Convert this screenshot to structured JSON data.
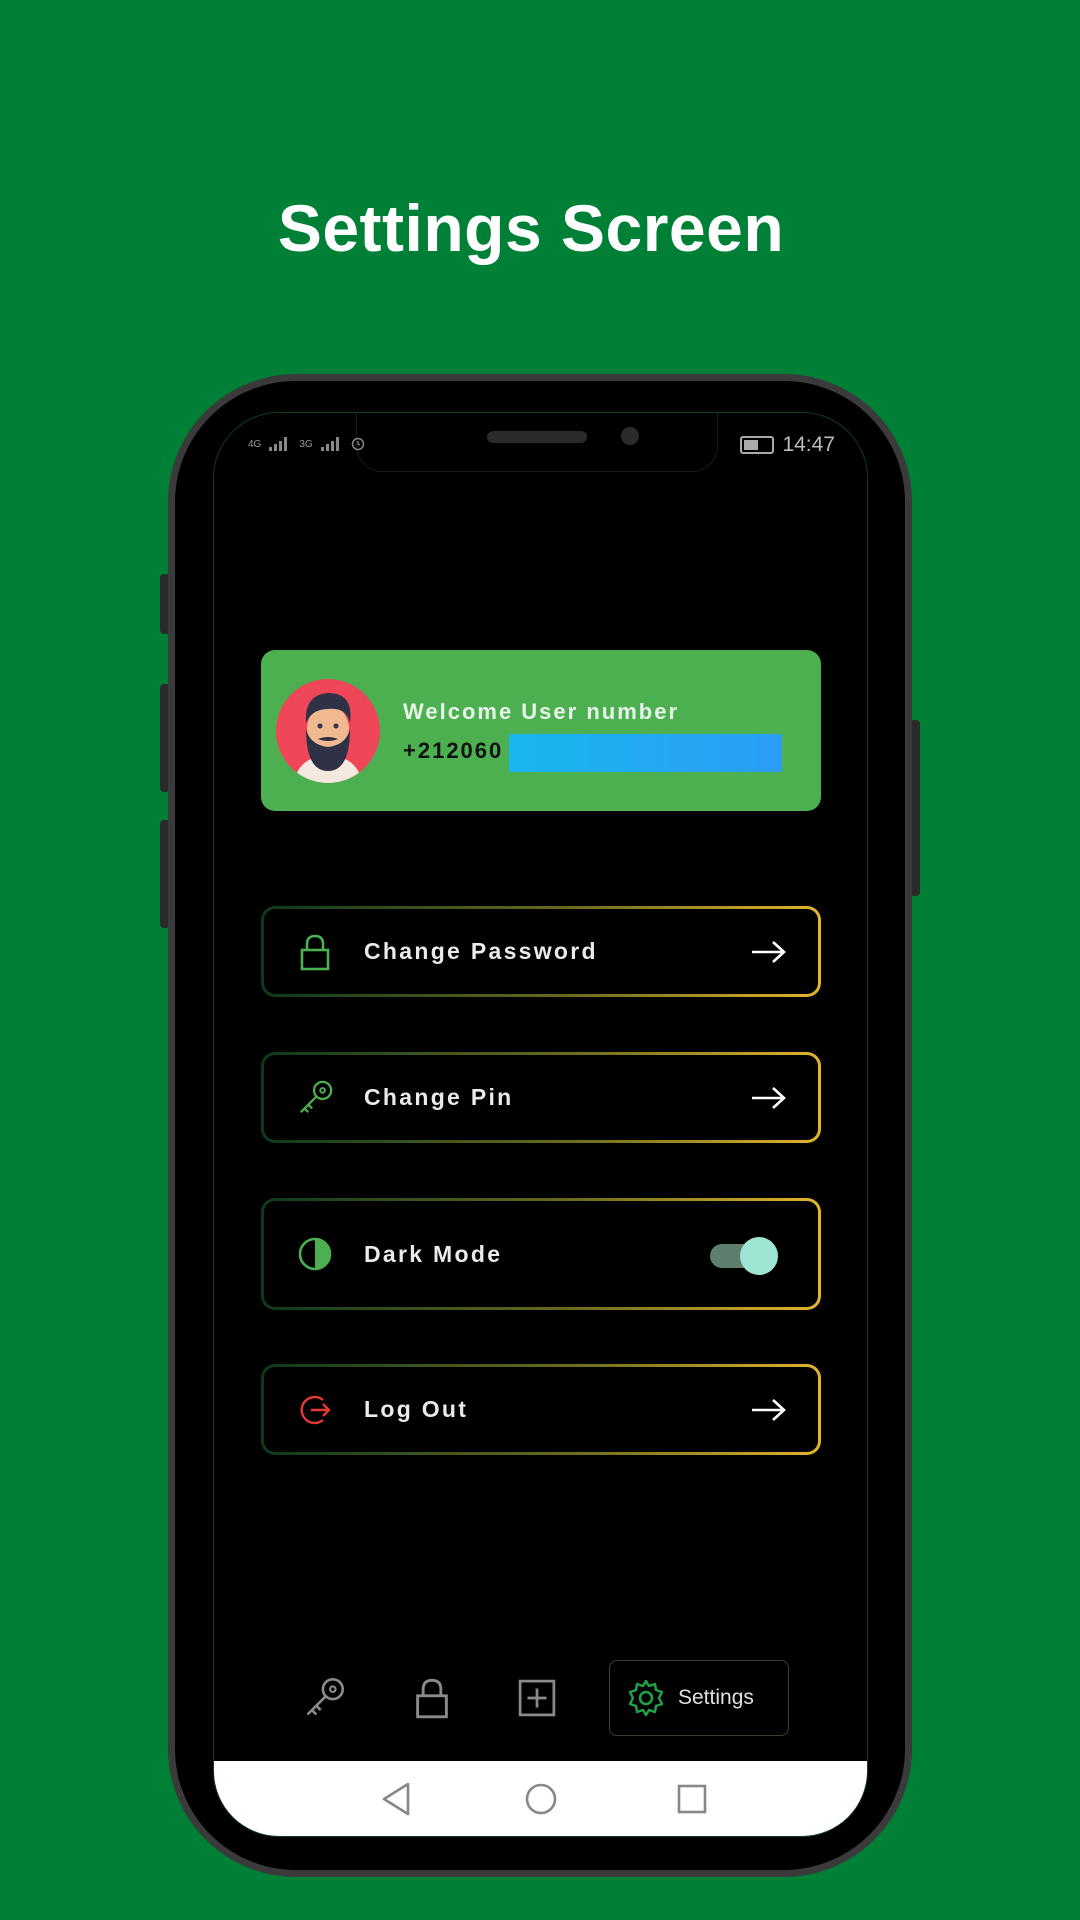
{
  "page": {
    "title": "Settings Screen"
  },
  "status_bar": {
    "left": [
      "4G",
      "3G"
    ],
    "time": "14:47"
  },
  "profile": {
    "welcome": "Welcome User number",
    "phone_prefix": "+212060"
  },
  "menu": [
    {
      "label": "Change Password",
      "icon": "lock-icon",
      "action": "arrow"
    },
    {
      "label": "Change Pin",
      "icon": "key-icon",
      "action": "arrow"
    },
    {
      "label": "Dark Mode",
      "icon": "half-circle-icon",
      "action": "toggle",
      "toggle_on": true
    },
    {
      "label": "Log Out",
      "icon": "logout-icon",
      "action": "arrow"
    }
  ],
  "bottom_nav": {
    "items": [
      "key-icon",
      "lock-icon",
      "add-square-icon",
      "gear-icon"
    ],
    "active_label": "Settings"
  },
  "colors": {
    "background": "#008037",
    "card": "#4caf50",
    "accent_green": "#4caf50",
    "logout_red": "#e53935",
    "border_gold": "#e3b42c"
  }
}
